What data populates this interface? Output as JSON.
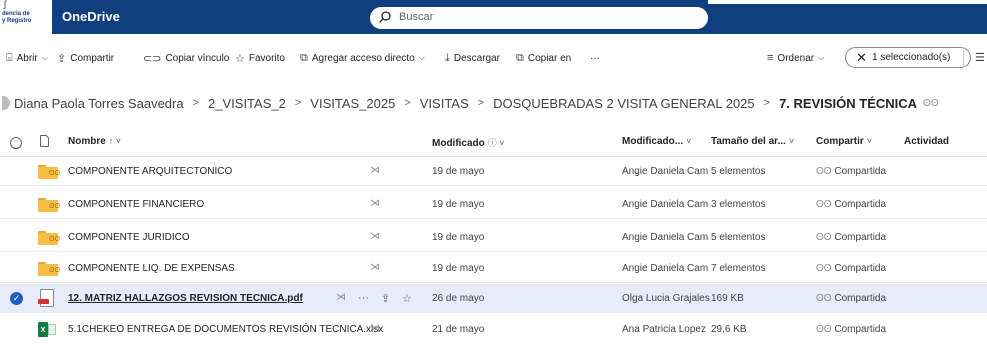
{
  "topbar": {
    "logo_line1": "dencia de",
    "logo_line2": "y Registro",
    "app_name": "OneDrive",
    "search_placeholder": "Buscar"
  },
  "commands": {
    "open": "Abrir",
    "share": "Compartir",
    "copy_link": "Copiar vínculo",
    "favorite": "Favorito",
    "add_shortcut": "Agregar acceso directo",
    "download": "Descargar",
    "copy_to": "Copiar en",
    "more": "···",
    "sort": "Ordenar",
    "selected": "1 seleccionado(s)"
  },
  "breadcrumb": {
    "items": [
      "Diana Paola Torres Saavedra",
      "2_VISITAS_2",
      "VISITAS_2025",
      "VISITAS",
      "DOSQUEBRADAS 2 VISITA GENERAL 2025"
    ],
    "current": "7. REVISIÓN TÉCNICA",
    "separator": ">"
  },
  "columns": {
    "name": "Nombre",
    "name_sort": "↑ ˅",
    "modified": "Modificado",
    "modified_sort": "ⓘ ˅",
    "modified_by": "Modificado...",
    "size": "Tamaño del ar...",
    "sharing": "Compartir",
    "activity": "Actividad",
    "chevron": "˅"
  },
  "files": [
    {
      "name": "COMPONENTE ARQUITECTONICO",
      "type": "folder",
      "modified": "19 de mayo",
      "modified_by": "Angie Daniela Cam",
      "size": "5 elementos",
      "sharing": "Compartida",
      "selected": false
    },
    {
      "name": "COMPONENTE FINANCIERO",
      "type": "folder",
      "modified": "19 de mayo",
      "modified_by": "Angie Daniela Cam",
      "size": "3 elementos",
      "sharing": "Compartida",
      "selected": false
    },
    {
      "name": "COMPONENTE JURIDICO",
      "type": "folder",
      "modified": "19 de mayo",
      "modified_by": "Angie Daniela Cam",
      "size": "5 elementos",
      "sharing": "Compartida",
      "selected": false
    },
    {
      "name": "COMPONENTE LIQ. DE EXPENSAS",
      "type": "folder",
      "modified": "19 de mayo",
      "modified_by": "Angie Daniela Cam",
      "size": "7 elementos",
      "sharing": "Compartida",
      "selected": false
    },
    {
      "name": "12. MATRIZ HALLAZGOS REVISION TECNICA.pdf",
      "type": "pdf",
      "modified": "26 de mayo",
      "modified_by": "Olga Lucia Grajales",
      "size": "169 KB",
      "sharing": "Compartida",
      "selected": true
    },
    {
      "name": "5.1CHEKEO ENTREGA DE DOCUMENTOS REVISIÓN TECNICA.xlsx",
      "type": "xlsx",
      "modified": "21 de mayo",
      "modified_by": "Ana Patricia Lopez",
      "size": "29,6 KB",
      "sharing": "Compartida",
      "selected": false
    }
  ]
}
